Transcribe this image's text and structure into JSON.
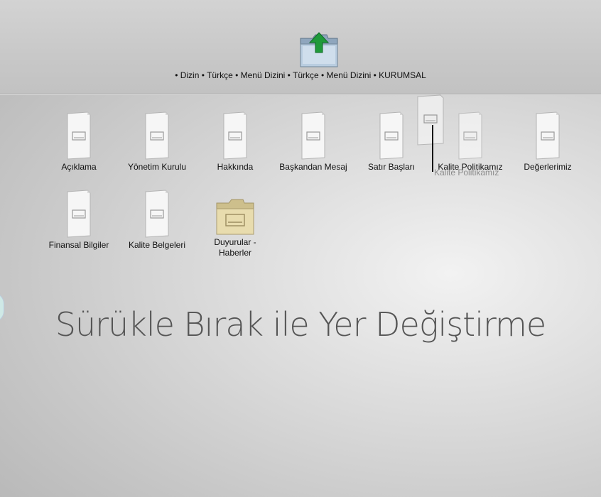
{
  "breadcrumb": {
    "items": [
      "• Dizin",
      "• Türkçe",
      "• Menü Dizini",
      "• Türkçe",
      "• Menü Dizini",
      "• KURUMSAL"
    ]
  },
  "items": [
    {
      "label": "Açıklama",
      "icon": "document-icon"
    },
    {
      "label": "Yönetim Kurulu",
      "icon": "document-icon"
    },
    {
      "label": "Hakkında",
      "icon": "document-icon"
    },
    {
      "label": "Başkandan Mesaj",
      "icon": "document-icon"
    },
    {
      "label": "Satır Başları",
      "icon": "document-icon"
    },
    {
      "label": "Kalite Politikamız",
      "icon": "document-icon"
    },
    {
      "label": "Değerlerimiz",
      "icon": "document-icon"
    },
    {
      "label": "Finansal Bilgiler",
      "icon": "document-icon"
    },
    {
      "label": "Kalite Belgeleri",
      "icon": "document-icon"
    },
    {
      "label": "Duyurular - Haberler",
      "icon": "folder-icon"
    }
  ],
  "drag_ghost": {
    "label": "Kalite Politikamız"
  },
  "heading": "Sürükle Bırak ile Yer Değiştirme",
  "colors": {
    "up_arrow": "#1f9a3a",
    "folder": "#e8dcae"
  }
}
